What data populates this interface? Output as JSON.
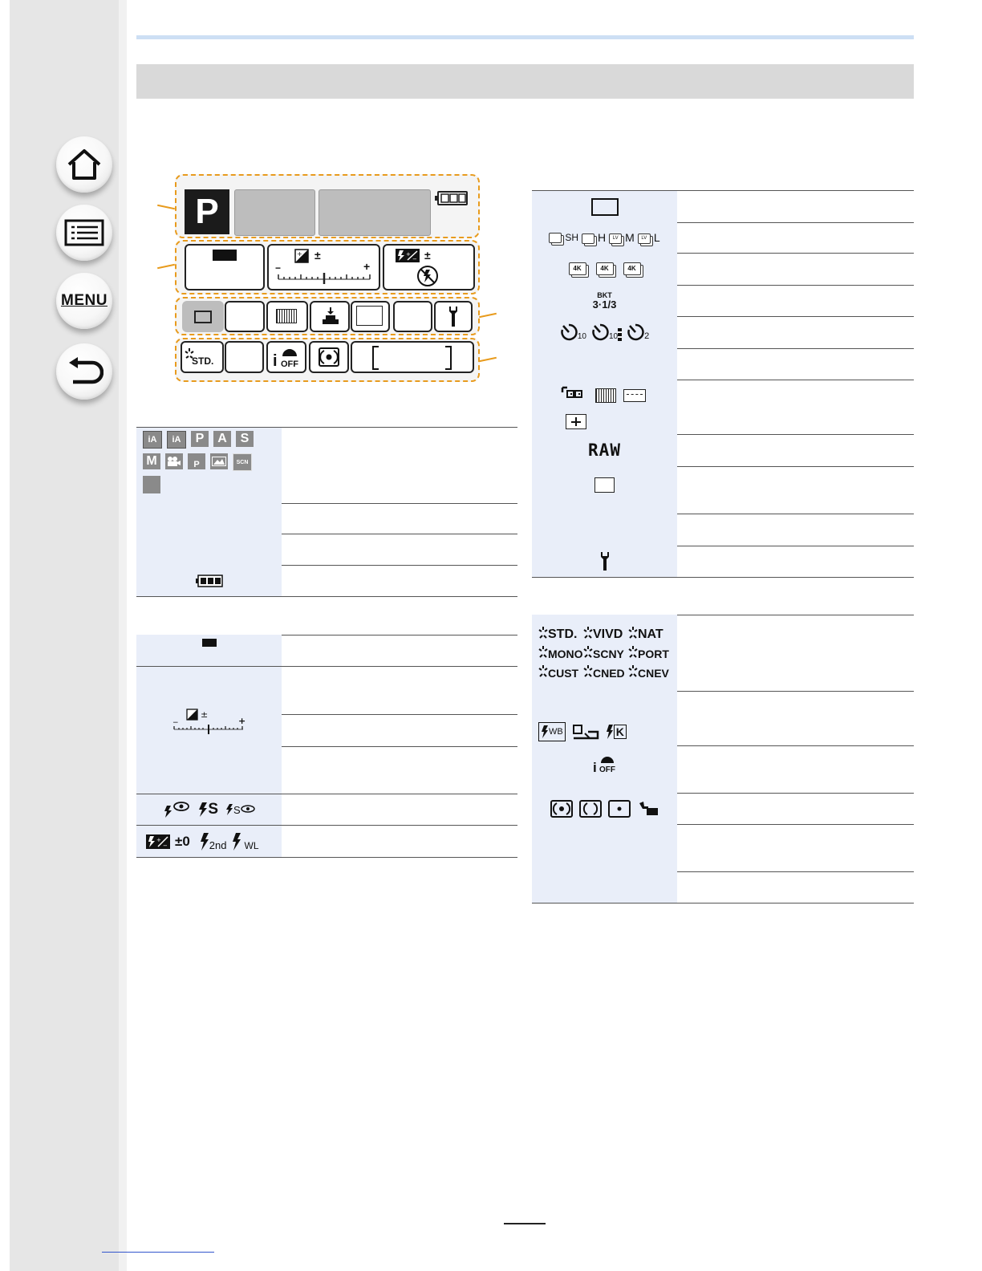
{
  "nav": {
    "menu_label": "MENU"
  },
  "panel": {
    "mode_letter": "P",
    "exposure_plus_minus": "±",
    "scale_minus": "−",
    "scale_plus": "+"
  },
  "right_table": {
    "bkt_top": "BKT",
    "bkt_bottom": "3·1/3",
    "raw": "RAW",
    "timer_10": "10",
    "timer_10b": "10",
    "timer_2": "2",
    "drive_sh": "SH",
    "drive_h": "H",
    "drive_m": "M",
    "drive_l": "L",
    "pp_4k_a": "4K",
    "pp_4k_b": "4K",
    "pp_4k_c": "4K"
  },
  "photo_styles": [
    "STD.",
    "VIVD",
    "NAT",
    "MONO",
    "SCNY",
    "PORT",
    "CUST",
    "CNED",
    "CNEV"
  ],
  "left_table": {
    "modes_row1": [
      "iA",
      "iA",
      "P",
      "A",
      "S"
    ],
    "modes_row2": [
      "M",
      "",
      "P",
      "",
      "SCN"
    ],
    "flash_adj_value": "±0",
    "flash_2nd": "2nd",
    "flash_wl": "WL",
    "flash_s": "S",
    "flash_s2": "S"
  },
  "lower_right": {
    "wb_label": "WB",
    "k_label": "K",
    "ioff": "OFF"
  }
}
